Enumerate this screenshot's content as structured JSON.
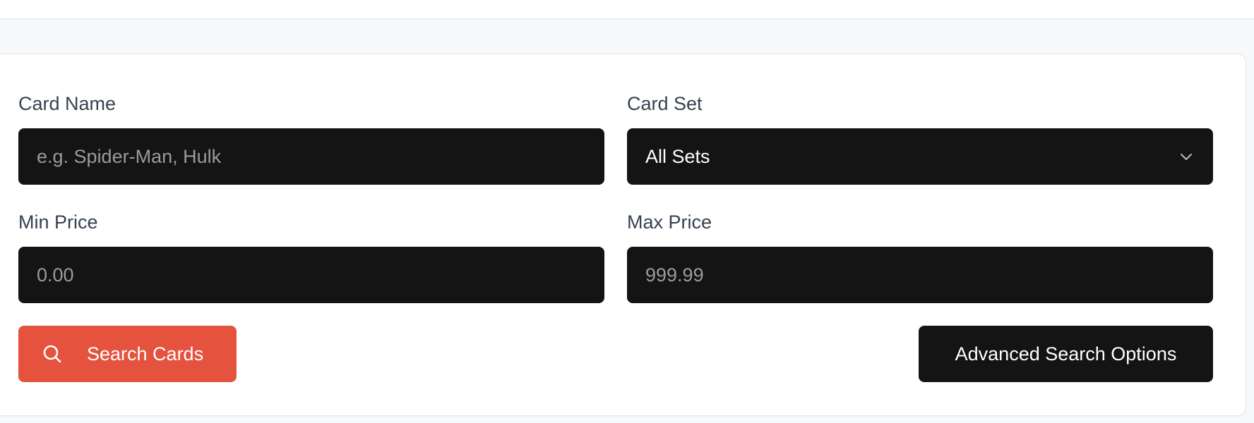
{
  "filters": {
    "card_name": {
      "label": "Card Name",
      "placeholder": "e.g. Spider-Man, Hulk",
      "value": ""
    },
    "card_set": {
      "label": "Card Set",
      "selected": "All Sets"
    },
    "min_price": {
      "label": "Min Price",
      "placeholder": "0.00",
      "value": ""
    },
    "max_price": {
      "label": "Max Price",
      "placeholder": "999.99",
      "value": ""
    }
  },
  "actions": {
    "search_label": "Search Cards",
    "advanced_label": "Advanced Search Options"
  },
  "colors": {
    "accent": "#e5533f",
    "field_background": "#141414",
    "label_text": "#374151",
    "page_background": "#f8f9fb"
  },
  "icons": {
    "search": "search-icon",
    "dropdown": "chevron-down-icon"
  }
}
